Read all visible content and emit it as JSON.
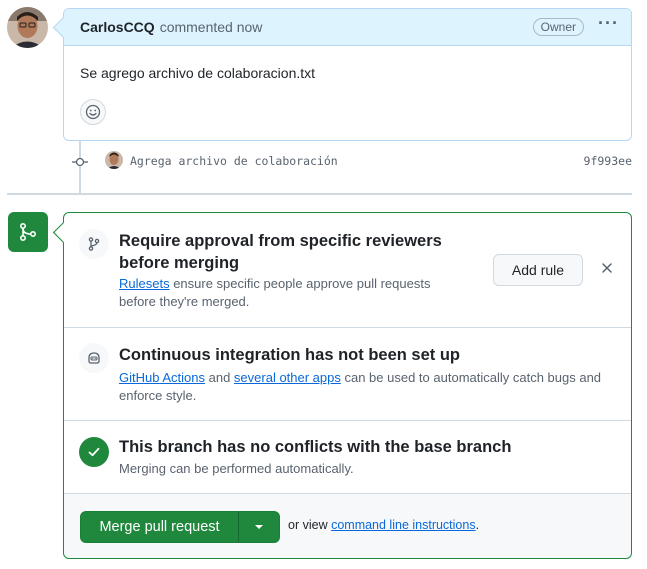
{
  "comment": {
    "author": "CarlosCCQ",
    "meta": "commented now",
    "badge": "Owner",
    "body": "Se agrego archivo de colaboracion.txt",
    "menu_icon": "kebab-horizontal-icon",
    "reaction_icon": "smiley-icon"
  },
  "commit": {
    "message": "Agrega archivo de colaboración",
    "sha": "9f993ee"
  },
  "merge": {
    "icon": "git-merge-icon",
    "approval": {
      "title": "Require approval from specific reviewers before merging",
      "link": "Rulesets",
      "desc": " ensure specific people approve pull requests before they're merged.",
      "button": "Add rule"
    },
    "ci": {
      "title": "Continuous integration has not been set up",
      "link1": "GitHub Actions",
      "and": " and ",
      "link2": "several other apps",
      "desc": " can be used to automatically catch bugs and enforce style."
    },
    "conflicts": {
      "title": "This branch has no conflicts with the base branch",
      "desc": "Merging can be performed automatically."
    },
    "actions": {
      "merge_button": "Merge pull request",
      "or_view": "or view ",
      "cli_link": "command line instructions",
      "period": "."
    }
  },
  "colors": {
    "accent_green": "#1f883d",
    "link_blue": "#0969da",
    "header_blue": "#ddf4ff"
  }
}
